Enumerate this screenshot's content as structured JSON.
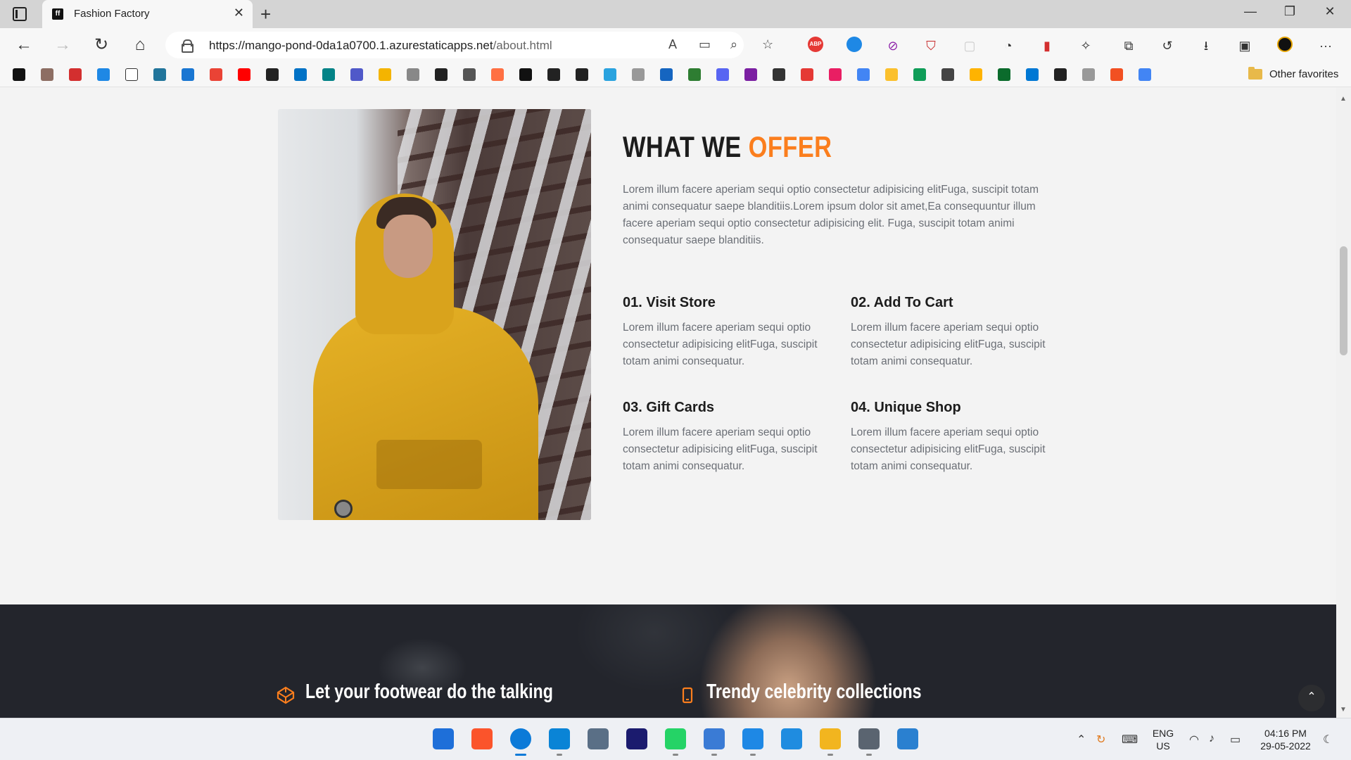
{
  "browser": {
    "tab_title": "Fashion Factory",
    "tab_favicon": "ff",
    "url_host": "https://mango-pond-0da1a0700.1.azurestaticapps.net",
    "url_path": "/about.html",
    "other_favorites": "Other favorites",
    "bookmark_icons": [
      "hackernews-icon",
      "bookmark-2",
      "pdf-icon",
      "is-icon",
      "page-icon",
      "wordpress-icon",
      "square-icon",
      "gmail-icon",
      "youtube-icon",
      "more-icon",
      "outlook-icon",
      "sharepoint-icon",
      "teams-icon",
      "dots-icon",
      "image-icon",
      "circle-icon",
      "qr-icon",
      "swirl-icon",
      "hashnode-icon",
      "github-icon",
      "github-icon-2",
      "telegram-icon",
      "bm-icon",
      "shield-icon",
      "green-icon",
      "discord-icon",
      "purple-icon",
      "cc-icon",
      "red-icon",
      "pen-icon",
      "google-icon",
      "gold-icon",
      "meet-icon",
      "eq-icon",
      "box-icon",
      "usf-icon",
      "azure-icon",
      "eye-icon",
      "grid-icon",
      "microsoft-icon",
      "google-icon-2"
    ],
    "ext_badges": {
      "abp": "ABP"
    }
  },
  "page": {
    "offer_title_main": "WHAT WE ",
    "offer_title_accent": "OFFER",
    "offer_description": "Lorem illum facere aperiam sequi optio consectetur adipisicing elitFuga, suscipit totam animi consequatur saepe blanditiis.Lorem ipsum dolor sit amet,Ea consequuntur illum facere aperiam sequi optio consectetur adipisicing elit. Fuga, suscipit totam animi consequatur saepe blanditiis.",
    "features": [
      {
        "title": "01. Visit Store",
        "text": "Lorem illum facere aperiam sequi optio consectetur adipisicing elitFuga, suscipit totam animi consequatur."
      },
      {
        "title": "02. Add To Cart",
        "text": "Lorem illum facere aperiam sequi optio consectetur adipisicing elitFuga, suscipit totam animi consequatur."
      },
      {
        "title": "03. Gift Cards",
        "text": "Lorem illum facere aperiam sequi optio consectetur adipisicing elitFuga, suscipit totam animi consequatur."
      },
      {
        "title": "04. Unique Shop",
        "text": "Lorem illum facere aperiam sequi optio consectetur adipisicing elitFuga, suscipit totam animi consequatur."
      }
    ],
    "promos": [
      {
        "text": "Let your footwear do the talking",
        "icon": "codepen-icon"
      },
      {
        "text": "Trendy celebrity collections",
        "icon": "mobile-icon"
      }
    ],
    "colors": {
      "accent": "#fb7e1d",
      "heading": "#1c1c1c",
      "body_text": "#6b6f76"
    }
  },
  "taskbar": {
    "apps": [
      "windows-start-icon",
      "brave-icon",
      "edge-icon",
      "vscode-icon",
      "camera-icon",
      "amazon-music-icon",
      "whatsapp-icon",
      "performance-icon",
      "notepad-icon",
      "vmware-icon",
      "file-explorer-icon",
      "settings-icon",
      "photos-icon"
    ],
    "language_line1": "ENG",
    "language_line2": "US",
    "time": "04:16 PM",
    "date": "29-05-2022"
  }
}
